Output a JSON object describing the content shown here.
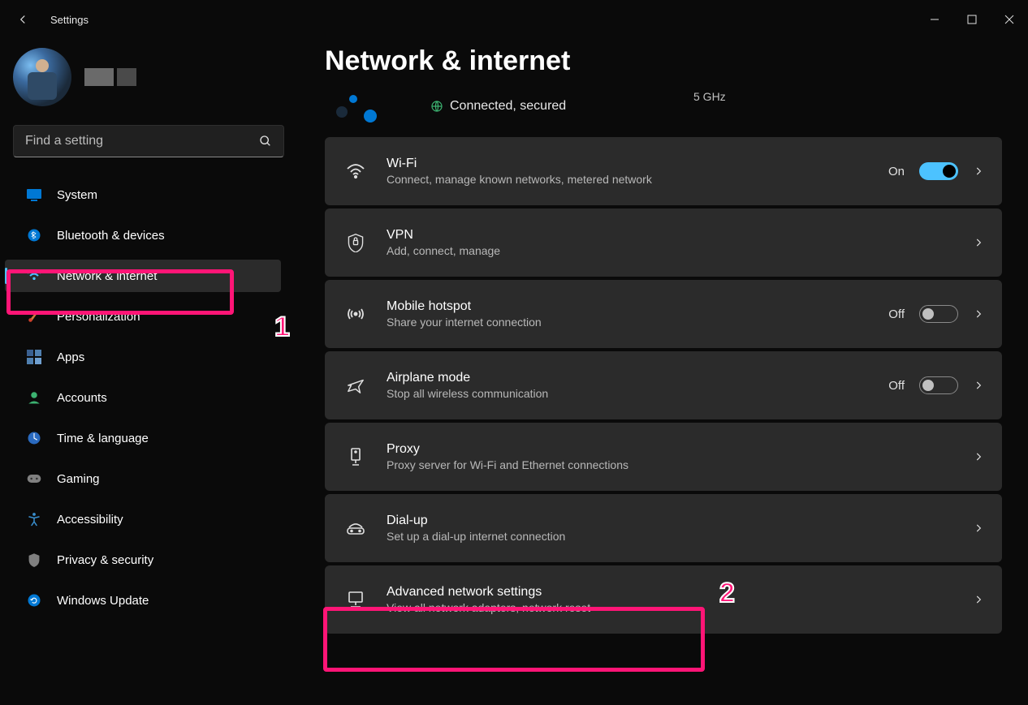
{
  "titlebar": {
    "title": "Settings"
  },
  "search": {
    "placeholder": "Find a setting"
  },
  "sidebar": {
    "items": [
      {
        "label": "System"
      },
      {
        "label": "Bluetooth & devices"
      },
      {
        "label": "Network & internet"
      },
      {
        "label": "Personalization"
      },
      {
        "label": "Apps"
      },
      {
        "label": "Accounts"
      },
      {
        "label": "Time & language"
      },
      {
        "label": "Gaming"
      },
      {
        "label": "Accessibility"
      },
      {
        "label": "Privacy & security"
      },
      {
        "label": "Windows Update"
      }
    ]
  },
  "page": {
    "title": "Network & internet",
    "status": {
      "connected": "Connected, secured",
      "col1_line2": "5 GHz"
    }
  },
  "cards": {
    "wifi": {
      "title": "Wi-Fi",
      "sub": "Connect, manage known networks, metered network",
      "state_label": "On"
    },
    "vpn": {
      "title": "VPN",
      "sub": "Add, connect, manage"
    },
    "hotspot": {
      "title": "Mobile hotspot",
      "sub": "Share your internet connection",
      "state_label": "Off"
    },
    "airplane": {
      "title": "Airplane mode",
      "sub": "Stop all wireless communication",
      "state_label": "Off"
    },
    "proxy": {
      "title": "Proxy",
      "sub": "Proxy server for Wi-Fi and Ethernet connections"
    },
    "dialup": {
      "title": "Dial-up",
      "sub": "Set up a dial-up internet connection"
    },
    "advanced": {
      "title": "Advanced network settings",
      "sub": "View all network adapters, network reset"
    }
  },
  "annotations": {
    "one": "1",
    "two": "2"
  }
}
